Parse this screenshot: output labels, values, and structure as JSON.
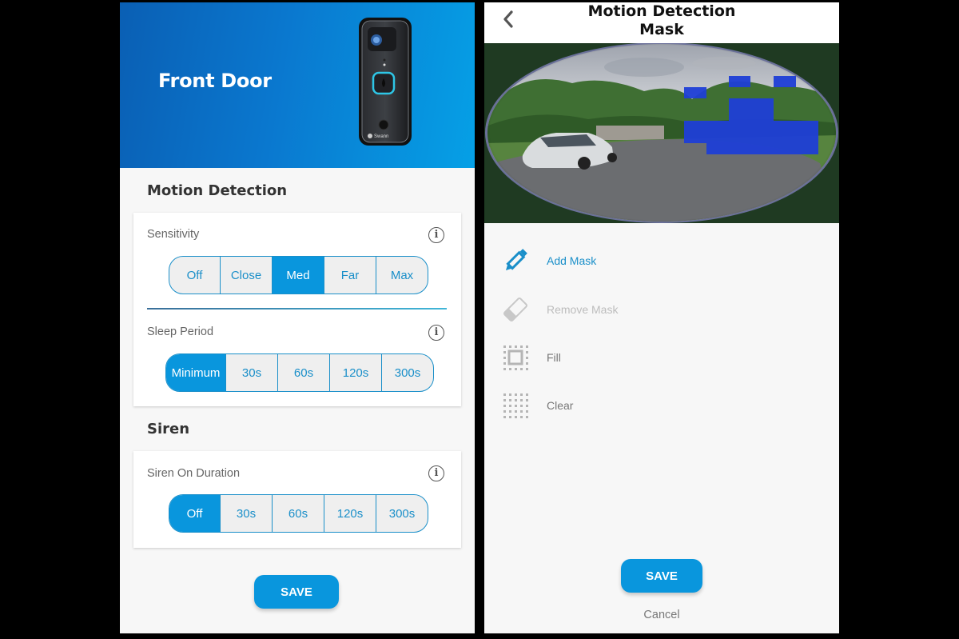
{
  "left_screen": {
    "device_name": "Front Door",
    "device_brand": "Swann",
    "motion_section": {
      "title": "Motion Detection",
      "sensitivity": {
        "label": "Sensitivity",
        "options": [
          "Off",
          "Close",
          "Med",
          "Far",
          "Max"
        ],
        "selected": "Med"
      },
      "sleep_period": {
        "label": "Sleep Period",
        "options": [
          "Minimum",
          "30s",
          "60s",
          "120s",
          "300s"
        ],
        "selected": "Minimum"
      }
    },
    "siren_section": {
      "title": "Siren",
      "siren_duration": {
        "label": "Siren On Duration",
        "options": [
          "Off",
          "30s",
          "60s",
          "120s",
          "300s"
        ],
        "selected": "Off"
      }
    },
    "save_label": "SAVE",
    "info_glyph": "i"
  },
  "right_screen": {
    "title_line1": "Motion Detection",
    "title_line2": "Mask",
    "back_icon": "chevron-left-icon",
    "tools": [
      {
        "label": "Add Mask",
        "icon": "pencil-icon",
        "state": "active"
      },
      {
        "label": "Remove Mask",
        "icon": "eraser-icon",
        "state": "disabled"
      },
      {
        "label": "Fill",
        "icon": "fill-grid-icon",
        "state": "normal"
      },
      {
        "label": "Clear",
        "icon": "clear-grid-icon",
        "state": "normal"
      }
    ],
    "save_label": "SAVE",
    "cancel_label": "Cancel"
  },
  "colors": {
    "accent": "#0996dd",
    "mask": "#1f3fd6",
    "hero_start": "#0a5fb4",
    "hero_end": "#05a0e6"
  }
}
